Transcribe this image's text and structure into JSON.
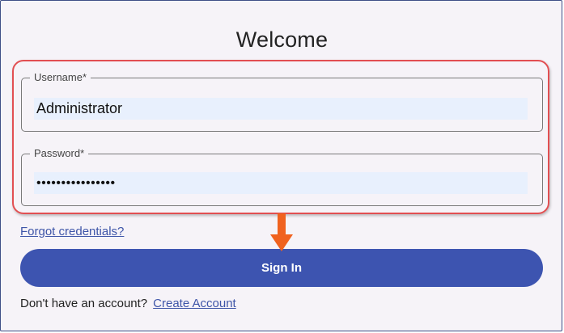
{
  "title": "Welcome",
  "username": {
    "label": "Username*",
    "value": "Administrator"
  },
  "password": {
    "label": "Password*",
    "value": "••••••••••••••••"
  },
  "forgot_link": "Forgot credentials?",
  "sign_in_label": "Sign In",
  "account_prompt": "Don't have an account?",
  "create_account_link": "Create Account",
  "colors": {
    "accent": "#3d54b0",
    "highlight": "#e24f52",
    "arrow": "#f0621f",
    "input_bg": "#e8f0fd"
  },
  "icons": {
    "annotation_arrow": "arrow-down-icon"
  }
}
